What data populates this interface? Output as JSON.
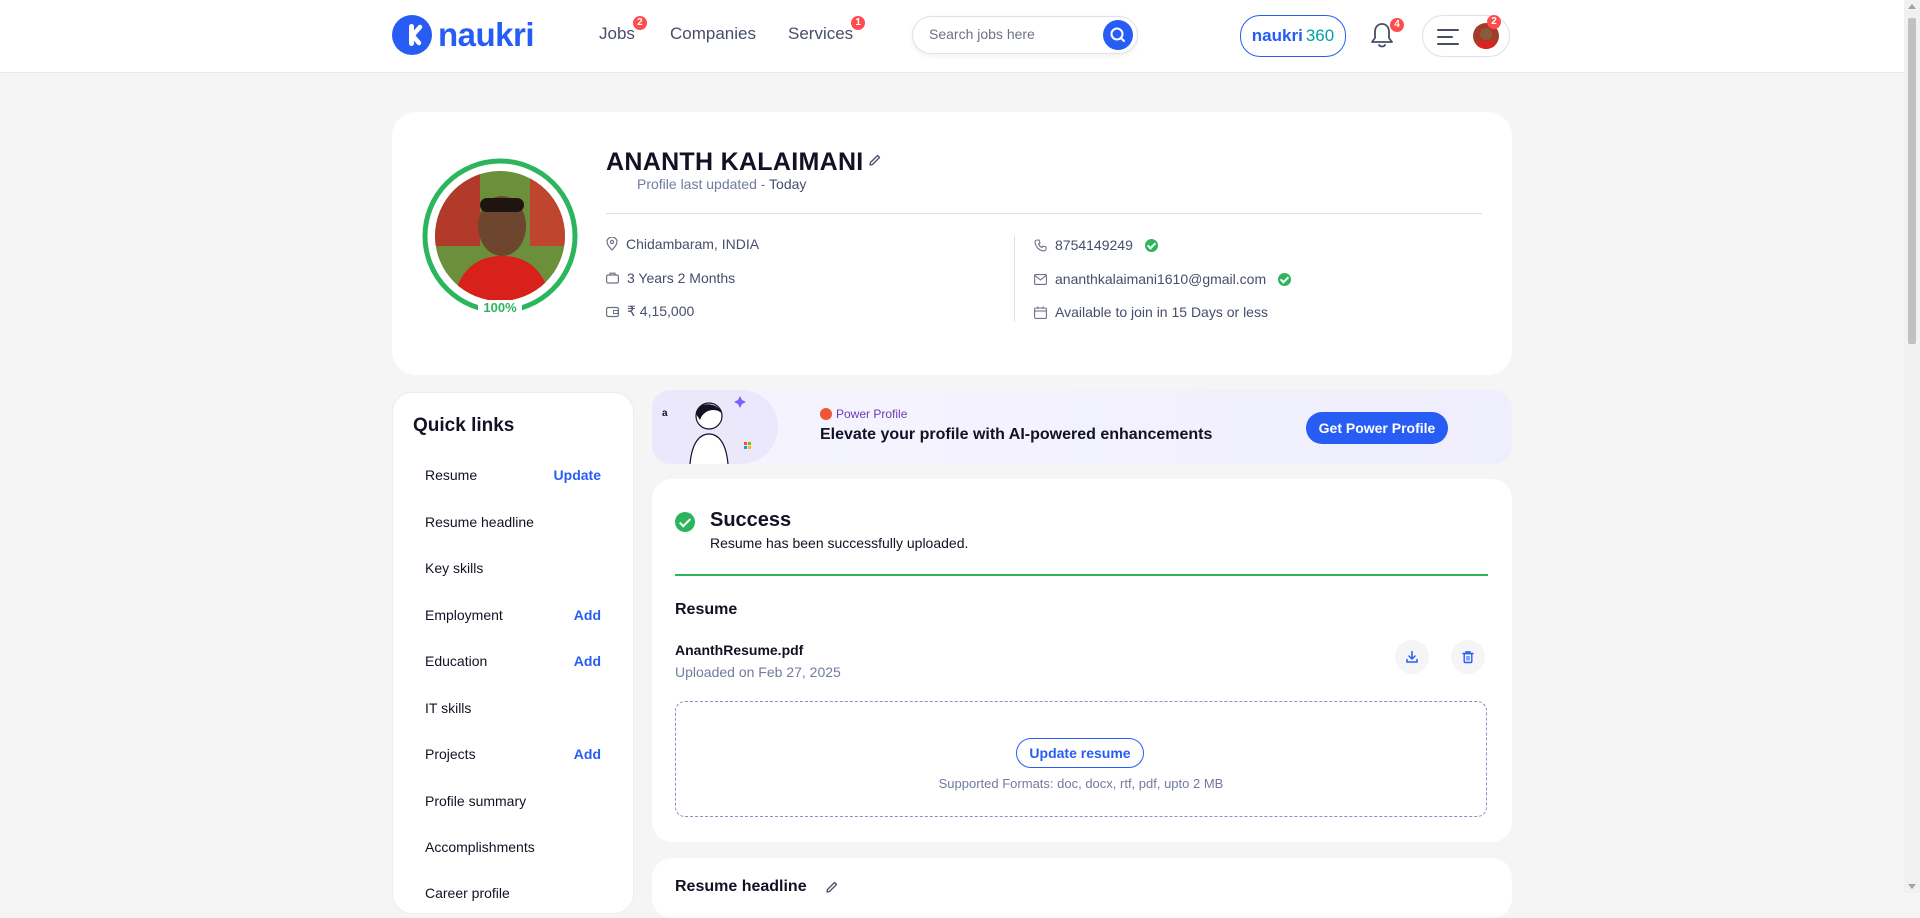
{
  "header": {
    "logo_text": "naukri",
    "nav": [
      {
        "label": "Jobs",
        "badge": "2"
      },
      {
        "label": "Companies",
        "badge": ""
      },
      {
        "label": "Services",
        "badge": "1"
      }
    ],
    "search_placeholder": "Search jobs here",
    "naukri360": {
      "part1": "naukri",
      "part2": "360"
    },
    "notifications_badge": "4",
    "menu_badge": "2"
  },
  "profile": {
    "name": "ANANTH KALAIMANI",
    "updated_label": "Profile last updated - ",
    "updated_value": "Today",
    "completion": "100%",
    "location": "Chidambaram, INDIA",
    "experience": "3 Years 2 Months",
    "salary": "₹ 4,15,000",
    "phone": "8754149249",
    "email": "ananthkalaimani1610@gmail.com",
    "notice": "Available to join in 15 Days or less"
  },
  "quick_links": {
    "title": "Quick links",
    "items": [
      {
        "label": "Resume",
        "action": "Update"
      },
      {
        "label": "Resume headline",
        "action": ""
      },
      {
        "label": "Key skills",
        "action": ""
      },
      {
        "label": "Employment",
        "action": "Add"
      },
      {
        "label": "Education",
        "action": "Add"
      },
      {
        "label": "IT skills",
        "action": ""
      },
      {
        "label": "Projects",
        "action": "Add"
      },
      {
        "label": "Profile summary",
        "action": ""
      },
      {
        "label": "Accomplishments",
        "action": ""
      },
      {
        "label": "Career profile",
        "action": ""
      }
    ]
  },
  "power_profile": {
    "tag": "Power Profile",
    "title": "Elevate your profile with AI-powered enhancements",
    "button": "Get Power Profile"
  },
  "resume_card": {
    "success_title": "Success",
    "success_message": "Resume has been successfully uploaded.",
    "section_title": "Resume",
    "file_name": "AnanthResume.pdf",
    "uploaded": "Uploaded on Feb 27, 2025",
    "update_button": "Update resume",
    "formats": "Supported Formats: doc, docx, rtf, pdf, upto 2 MB"
  },
  "headline_card": {
    "title": "Resume headline"
  },
  "colors": {
    "brand": "#275df5",
    "success": "#2db55d",
    "badge": "#ff4d4f"
  },
  "icons": [
    "location-icon",
    "briefcase-icon",
    "wallet-icon",
    "phone-icon",
    "mail-icon",
    "calendar-icon",
    "bell-icon",
    "search-icon",
    "download-icon",
    "delete-icon",
    "edit-icon",
    "hamburger-icon"
  ]
}
